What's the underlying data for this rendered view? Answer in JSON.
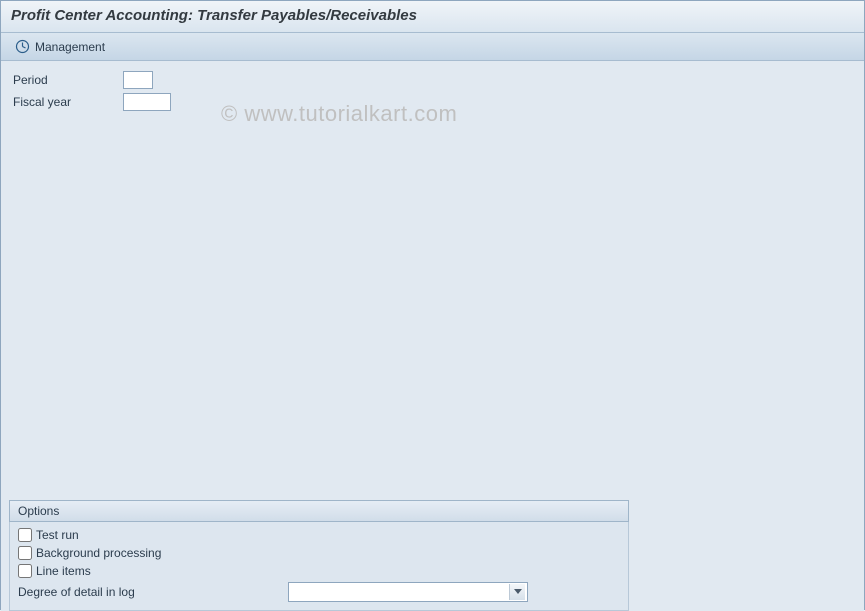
{
  "header": {
    "title": "Profit Center Accounting: Transfer Payables/Receivables"
  },
  "toolbar": {
    "management_label": "Management"
  },
  "fields": {
    "period": {
      "label": "Period",
      "value": ""
    },
    "fiscal_year": {
      "label": "Fiscal year",
      "value": ""
    }
  },
  "options": {
    "panel_title": "Options",
    "test_run": {
      "label": "Test run",
      "checked": false
    },
    "background_processing": {
      "label": "Background processing",
      "checked": false
    },
    "line_items": {
      "label": "Line items",
      "checked": false
    },
    "degree_of_detail": {
      "label": "Degree of detail in log",
      "value": ""
    }
  },
  "watermark": "© www.tutorialkart.com"
}
